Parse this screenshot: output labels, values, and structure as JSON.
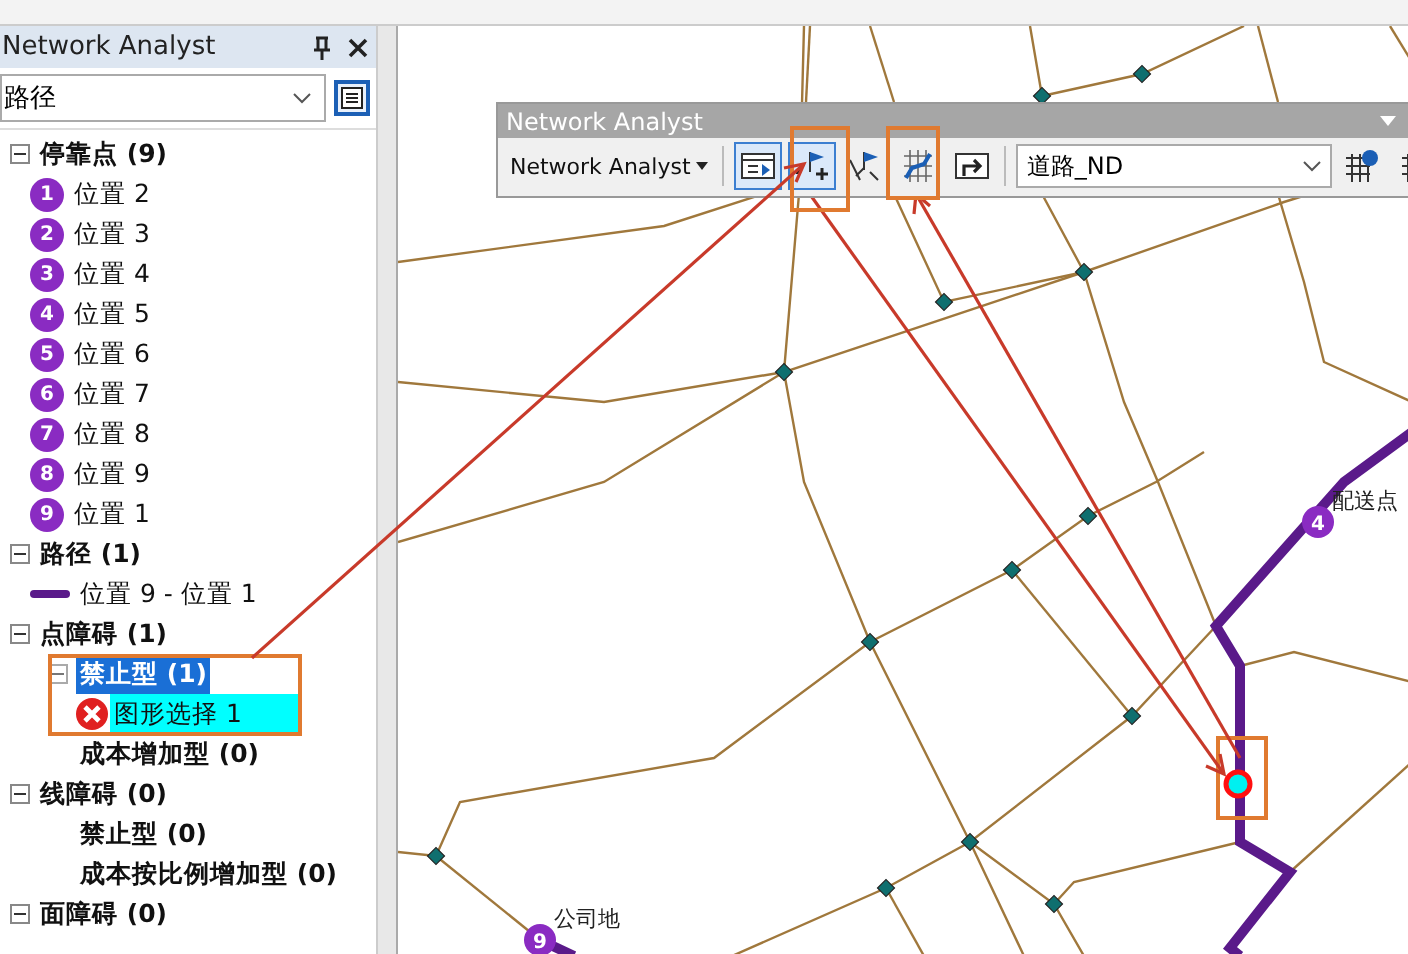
{
  "panel": {
    "title": "Network Analyst",
    "layer_dropdown": {
      "value": "路径"
    },
    "tree": [
      {
        "label": "停靠点 (9)",
        "expanded": true,
        "children": [
          {
            "kind": "stop",
            "badge": "1",
            "label": "位置 2"
          },
          {
            "kind": "stop",
            "badge": "2",
            "label": "位置 3"
          },
          {
            "kind": "stop",
            "badge": "3",
            "label": "位置 4"
          },
          {
            "kind": "stop",
            "badge": "4",
            "label": "位置 5"
          },
          {
            "kind": "stop",
            "badge": "5",
            "label": "位置 6"
          },
          {
            "kind": "stop",
            "badge": "6",
            "label": "位置 7"
          },
          {
            "kind": "stop",
            "badge": "7",
            "label": "位置 8"
          },
          {
            "kind": "stop",
            "badge": "8",
            "label": "位置 9"
          },
          {
            "kind": "stop",
            "badge": "9",
            "label": "位置 1"
          }
        ]
      },
      {
        "label": "路径 (1)",
        "expanded": true,
        "children": [
          {
            "kind": "route",
            "label": "位置 9 - 位置 1"
          }
        ]
      },
      {
        "label": "点障碍 (1)",
        "expanded": true,
        "children": [
          {
            "kind": "category",
            "label": "禁止型 (1)",
            "selected": true,
            "expanded": true,
            "children": [
              {
                "kind": "barrier",
                "label": "图形选择 1",
                "selected": true
              }
            ]
          },
          {
            "kind": "category",
            "label": "成本增加型 (0)",
            "selected": false
          }
        ]
      },
      {
        "label": "线障碍 (0)",
        "expanded": true,
        "children": [
          {
            "kind": "category",
            "label": "禁止型 (0)",
            "selected": false
          },
          {
            "kind": "category",
            "label": "成本按比例增加型 (0)",
            "selected": false
          }
        ]
      },
      {
        "label": "面障碍 (0)",
        "expanded": true
      }
    ]
  },
  "toolbar": {
    "title": "Network Analyst",
    "menu": "Network Analyst",
    "network_dropdown": {
      "value": "道路_ND"
    },
    "tools": [
      {
        "kind": "window",
        "pressed": true
      },
      {
        "kind": "create-location",
        "pressed": true
      },
      {
        "kind": "select-location",
        "pressed": false
      },
      {
        "kind": "solve",
        "pressed": false
      },
      {
        "kind": "directions",
        "pressed": false
      }
    ],
    "end_tools": [
      {
        "kind": "build"
      },
      {
        "kind": "grid"
      }
    ]
  },
  "map": {
    "stops": [
      {
        "badge": "4",
        "label": "配送点"
      },
      {
        "badge": "9",
        "label": "公司地"
      }
    ],
    "barriers": [
      {
        "selected": true
      }
    ]
  }
}
